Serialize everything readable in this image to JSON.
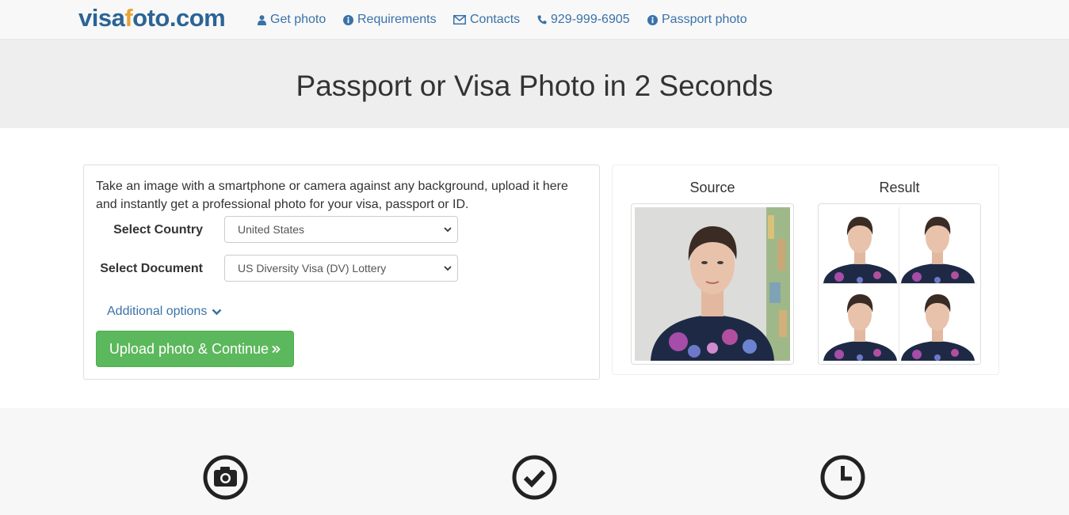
{
  "brand": {
    "part1": "visa",
    "part2": "f",
    "part3": "oto",
    "part4": ".com"
  },
  "nav": [
    {
      "label": "Get photo",
      "icon": "user-icon"
    },
    {
      "label": "Requirements",
      "icon": "info-circle-icon"
    },
    {
      "label": "Contacts",
      "icon": "envelope-icon"
    },
    {
      "label": "929-999-6905",
      "icon": "phone-icon"
    },
    {
      "label": "Passport photo",
      "icon": "info-circle-icon"
    }
  ],
  "hero": {
    "title": "Passport or Visa Photo in 2 Seconds"
  },
  "form": {
    "intro": "Take an image with a smartphone or camera against any background, upload it here and instantly get a professional photo for your visa, passport or ID.",
    "country_label": "Select Country",
    "country_value": "United States",
    "document_label": "Select Document",
    "document_value": "US Diversity Visa (DV) Lottery",
    "additional_options": "Additional options",
    "upload_button": "Upload photo & Continue"
  },
  "sample": {
    "source_label": "Source",
    "result_label": "Result"
  },
  "features": [
    {
      "icon": "camera-icon"
    },
    {
      "icon": "check-circle-icon"
    },
    {
      "icon": "clock-icon"
    }
  ],
  "colors": {
    "brand_blue": "#2b6496",
    "brand_orange": "#e8a33a",
    "link": "#3a72a8",
    "success": "#5cb85c"
  }
}
